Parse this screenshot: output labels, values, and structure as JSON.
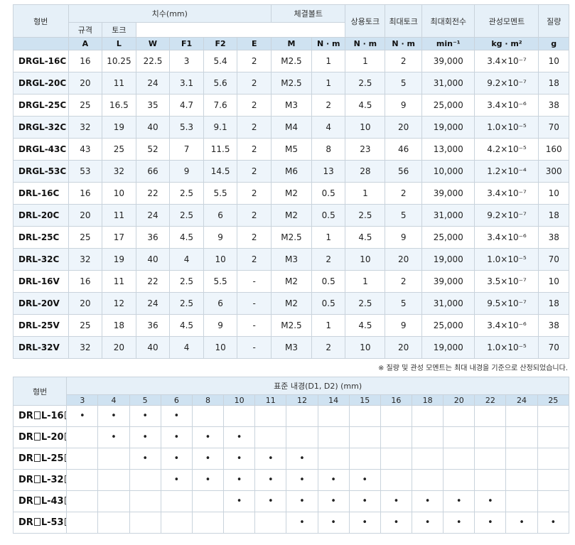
{
  "spec": {
    "header": {
      "model": "형번",
      "dimensions": "치수(mm)",
      "bolt": "체결볼트",
      "bolt_spec": "규격",
      "bolt_torque": "토크",
      "rated_torque": "상용토크",
      "max_torque": "최대토크",
      "max_speed": "최대회전수",
      "inertia": "관성모멘트",
      "mass": "질량"
    },
    "units": [
      "A",
      "L",
      "W",
      "F1",
      "F2",
      "E",
      "M",
      "N · m",
      "N · m",
      "N · m",
      "min⁻¹",
      "kg · m²",
      "g"
    ],
    "rows": [
      {
        "model": "DRGL-16C",
        "c": [
          "16",
          "10.25",
          "22.5",
          "3",
          "5.4",
          "2",
          "M2.5",
          "1",
          "1",
          "2",
          "39,000",
          "3.4×10⁻⁷",
          "10"
        ]
      },
      {
        "model": "DRGL-20C",
        "c": [
          "20",
          "11",
          "24",
          "3.1",
          "5.6",
          "2",
          "M2.5",
          "1",
          "2.5",
          "5",
          "31,000",
          "9.2×10⁻⁷",
          "18"
        ]
      },
      {
        "model": "DRGL-25C",
        "c": [
          "25",
          "16.5",
          "35",
          "4.7",
          "7.6",
          "2",
          "M3",
          "2",
          "4.5",
          "9",
          "25,000",
          "3.4×10⁻⁶",
          "38"
        ]
      },
      {
        "model": "DRGL-32C",
        "c": [
          "32",
          "19",
          "40",
          "5.3",
          "9.1",
          "2",
          "M4",
          "4",
          "10",
          "20",
          "19,000",
          "1.0×10⁻⁵",
          "70"
        ]
      },
      {
        "model": "DRGL-43C",
        "c": [
          "43",
          "25",
          "52",
          "7",
          "11.5",
          "2",
          "M5",
          "8",
          "23",
          "46",
          "13,000",
          "4.2×10⁻⁵",
          "160"
        ]
      },
      {
        "model": "DRGL-53C",
        "c": [
          "53",
          "32",
          "66",
          "9",
          "14.5",
          "2",
          "M6",
          "13",
          "28",
          "56",
          "10,000",
          "1.2×10⁻⁴",
          "300"
        ]
      },
      {
        "model": "DRL-16C",
        "c": [
          "16",
          "10",
          "22",
          "2.5",
          "5.5",
          "2",
          "M2",
          "0.5",
          "1",
          "2",
          "39,000",
          "3.4×10⁻⁷",
          "10"
        ]
      },
      {
        "model": "DRL-20C",
        "c": [
          "20",
          "11",
          "24",
          "2.5",
          "6",
          "2",
          "M2",
          "0.5",
          "2.5",
          "5",
          "31,000",
          "9.2×10⁻⁷",
          "18"
        ]
      },
      {
        "model": "DRL-25C",
        "c": [
          "25",
          "17",
          "36",
          "4.5",
          "9",
          "2",
          "M2.5",
          "1",
          "4.5",
          "9",
          "25,000",
          "3.4×10⁻⁶",
          "38"
        ]
      },
      {
        "model": "DRL-32C",
        "c": [
          "32",
          "19",
          "40",
          "4",
          "10",
          "2",
          "M3",
          "2",
          "10",
          "20",
          "19,000",
          "1.0×10⁻⁵",
          "70"
        ]
      },
      {
        "model": "DRL-16V",
        "c": [
          "16",
          "11",
          "22",
          "2.5",
          "5.5",
          "-",
          "M2",
          "0.5",
          "1",
          "2",
          "39,000",
          "3.5×10⁻⁷",
          "10"
        ]
      },
      {
        "model": "DRL-20V",
        "c": [
          "20",
          "12",
          "24",
          "2.5",
          "6",
          "-",
          "M2",
          "0.5",
          "2.5",
          "5",
          "31,000",
          "9.5×10⁻⁷",
          "18"
        ]
      },
      {
        "model": "DRL-25V",
        "c": [
          "25",
          "18",
          "36",
          "4.5",
          "9",
          "-",
          "M2.5",
          "1",
          "4.5",
          "9",
          "25,000",
          "3.4×10⁻⁶",
          "38"
        ]
      },
      {
        "model": "DRL-32V",
        "c": [
          "32",
          "20",
          "40",
          "4",
          "10",
          "-",
          "M3",
          "2",
          "10",
          "20",
          "19,000",
          "1.0×10⁻⁵",
          "70"
        ]
      }
    ],
    "note": "※ 질량 및 관성 모멘트는 최대 내경을 기준으로 산정되었습니다."
  },
  "bore": {
    "header": {
      "model": "형번",
      "title": "표준 내경(D1, D2) (mm)"
    },
    "sizes": [
      "3",
      "4",
      "5",
      "6",
      "8",
      "10",
      "11",
      "12",
      "14",
      "15",
      "16",
      "18",
      "20",
      "22",
      "24",
      "25"
    ],
    "dot": "•",
    "rows": [
      {
        "prefix": "DR",
        "mid": "L-16",
        "avail": [
          1,
          1,
          1,
          1,
          0,
          0,
          0,
          0,
          0,
          0,
          0,
          0,
          0,
          0,
          0,
          0
        ]
      },
      {
        "prefix": "DR",
        "mid": "L-20",
        "avail": [
          0,
          1,
          1,
          1,
          1,
          1,
          0,
          0,
          0,
          0,
          0,
          0,
          0,
          0,
          0,
          0
        ]
      },
      {
        "prefix": "DR",
        "mid": "L-25",
        "avail": [
          0,
          0,
          1,
          1,
          1,
          1,
          1,
          1,
          0,
          0,
          0,
          0,
          0,
          0,
          0,
          0
        ]
      },
      {
        "prefix": "DR",
        "mid": "L-32",
        "avail": [
          0,
          0,
          0,
          1,
          1,
          1,
          1,
          1,
          1,
          1,
          0,
          0,
          0,
          0,
          0,
          0
        ]
      },
      {
        "prefix": "DR",
        "mid": "L-43",
        "avail": [
          0,
          0,
          0,
          0,
          0,
          1,
          1,
          1,
          1,
          1,
          1,
          1,
          1,
          1,
          0,
          0
        ]
      },
      {
        "prefix": "DR",
        "mid": "L-53",
        "avail": [
          0,
          0,
          0,
          0,
          0,
          0,
          0,
          1,
          1,
          1,
          1,
          1,
          1,
          1,
          1,
          1
        ]
      }
    ]
  }
}
